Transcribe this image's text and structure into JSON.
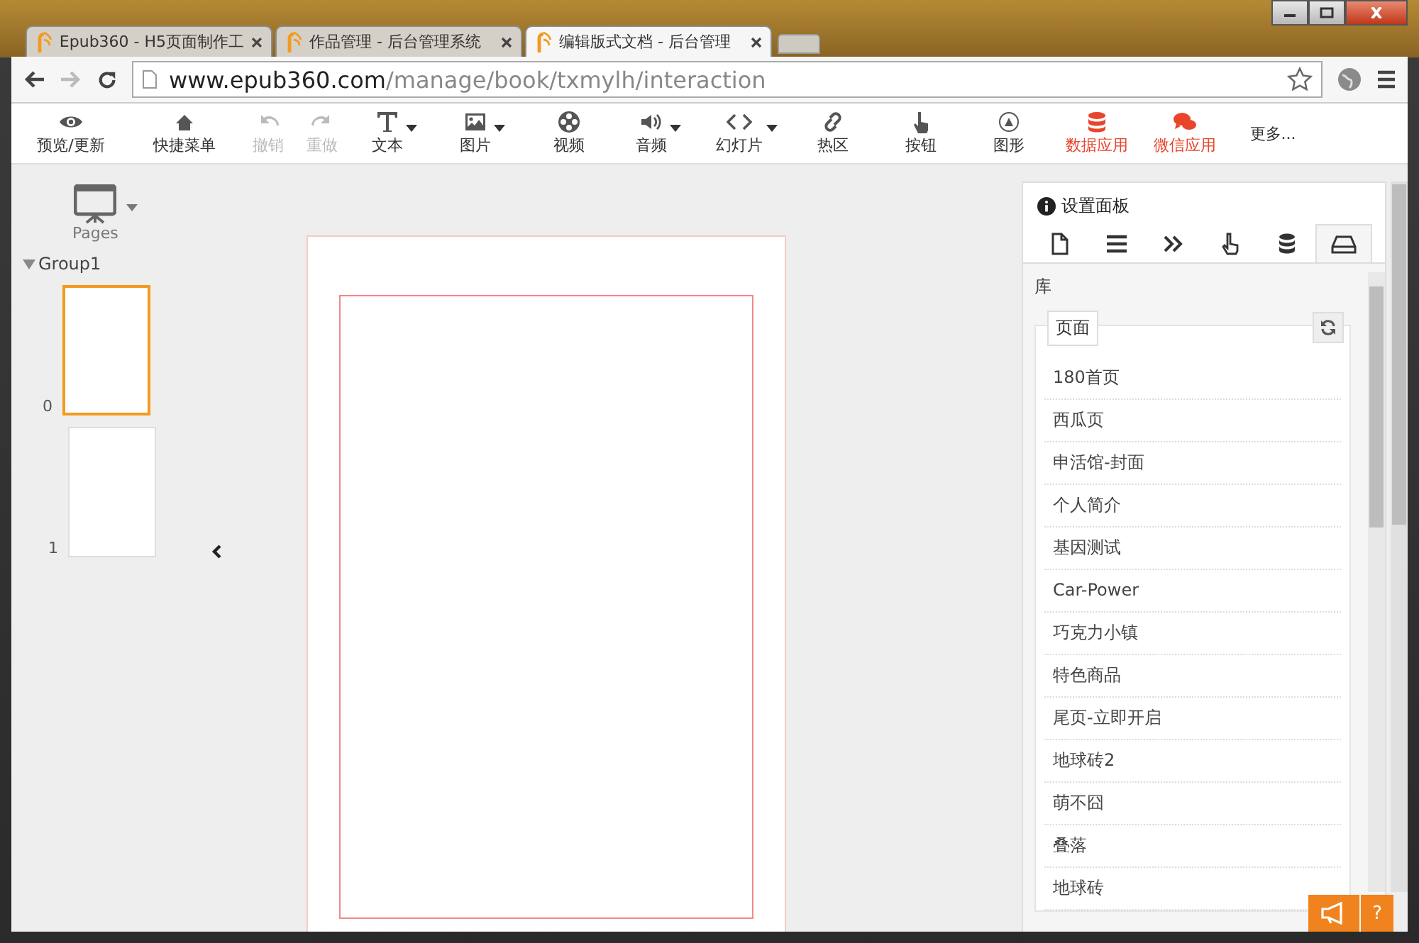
{
  "browser": {
    "tabs": [
      {
        "title": "Epub360 - H5页面制作工",
        "selected": false
      },
      {
        "title": "作品管理 - 后台管理系统",
        "selected": false
      },
      {
        "title": "编辑版式文档 - 后台管理",
        "selected": true
      }
    ],
    "url_host": "www.epub360.com",
    "url_path": "/manage/book/txmylh/interaction"
  },
  "toolbar": [
    {
      "kind": "eye",
      "label": "预览/更新",
      "disabled": false,
      "dropdown": false,
      "color": "#333333"
    },
    {
      "kind": "home",
      "label": "快捷菜单",
      "disabled": false,
      "dropdown": false,
      "color": "#333333"
    },
    {
      "kind": "undo",
      "label": "撤销",
      "disabled": true,
      "dropdown": false
    },
    {
      "kind": "redo",
      "label": "重做",
      "disabled": true,
      "dropdown": false
    },
    {
      "kind": "text",
      "label": "文本",
      "disabled": false,
      "dropdown": true,
      "color": "#333333"
    },
    {
      "kind": "image",
      "label": "图片",
      "disabled": false,
      "dropdown": true,
      "color": "#333333"
    },
    {
      "kind": "video",
      "label": "视频",
      "disabled": false,
      "dropdown": false,
      "color": "#333333"
    },
    {
      "kind": "audio",
      "label": "音频",
      "disabled": false,
      "dropdown": true,
      "color": "#333333"
    },
    {
      "kind": "code",
      "label": "幻灯片",
      "disabled": false,
      "dropdown": true,
      "color": "#333333"
    },
    {
      "kind": "link",
      "label": "热区",
      "disabled": false,
      "dropdown": false,
      "color": "#333333"
    },
    {
      "kind": "hand",
      "label": "按钮",
      "disabled": false,
      "dropdown": false,
      "color": "#333333"
    },
    {
      "kind": "shape",
      "label": "图形",
      "disabled": false,
      "dropdown": false,
      "color": "#333333"
    },
    {
      "kind": "database",
      "label": "数据应用",
      "disabled": false,
      "dropdown": false,
      "color": "#e8452c"
    },
    {
      "kind": "chat",
      "label": "微信应用",
      "disabled": false,
      "dropdown": false,
      "color": "#e8452c"
    },
    {
      "kind": "more",
      "label": "更多...",
      "disabled": false,
      "dropdown": false,
      "color": "#333333"
    }
  ],
  "pages_panel": {
    "label": "Pages",
    "group": {
      "name": "Group1",
      "expanded": true,
      "pages": [
        {
          "number": "0",
          "selected": true
        },
        {
          "number": "1",
          "selected": false
        }
      ]
    }
  },
  "settings_panel": {
    "title": "设置面板",
    "tabs": [
      {
        "kind": "page",
        "selected": false
      },
      {
        "kind": "list",
        "selected": false
      },
      {
        "kind": "forward",
        "selected": false
      },
      {
        "kind": "hand",
        "selected": false
      },
      {
        "kind": "database",
        "selected": false
      },
      {
        "kind": "drive",
        "selected": true
      }
    ],
    "section_label": "库",
    "box_legend": "页面",
    "items": [
      "180首页",
      "西瓜页",
      "申活馆-封面",
      "个人简介",
      "基因测试",
      "Car-Power",
      "巧克力小镇",
      "特色商品",
      "尾页-立即开启",
      "地球砖2",
      "萌不囧",
      "叠落",
      "地球砖"
    ]
  },
  "help_button": "?"
}
